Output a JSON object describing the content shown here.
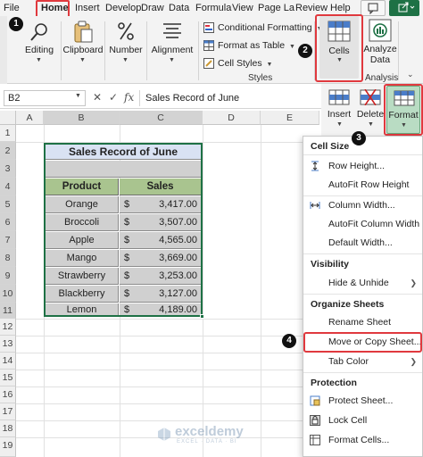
{
  "tabs": [
    "File",
    "Home",
    "Insert",
    "Develop",
    "Draw",
    "Data",
    "Formula",
    "View",
    "Page La",
    "Review",
    "Help"
  ],
  "ribbon": {
    "editing": "Editing",
    "clipboard": "Clipboard",
    "number": "Number",
    "alignment": "Alignment",
    "conditional_formatting": "Conditional Formatting",
    "format_as_table": "Format as Table",
    "cell_styles": "Cell Styles",
    "styles_group": "Styles",
    "cells": "Cells",
    "analyze_data": [
      "Analyze",
      "Data"
    ],
    "analysis_group": "Analysis"
  },
  "cells_group": {
    "insert": "Insert",
    "delete": "Delete",
    "format": "Format"
  },
  "formula_bar": {
    "name_box": "B2",
    "fx": "fx",
    "content": "Sales Record of June"
  },
  "columns": [
    "A",
    "B",
    "C",
    "D",
    "E"
  ],
  "rows": [
    "1",
    "2",
    "3",
    "4",
    "5",
    "6",
    "7",
    "8",
    "9",
    "10",
    "11",
    "12",
    "13",
    "14",
    "15",
    "16",
    "17",
    "18",
    "19"
  ],
  "sheet": {
    "title": "Sales Record of June",
    "header_product": "Product",
    "header_sales": "Sales",
    "currency": "$",
    "rows": [
      {
        "product": "Orange",
        "sales": "3,417.00"
      },
      {
        "product": "Broccoli",
        "sales": "3,507.00"
      },
      {
        "product": "Apple",
        "sales": "4,565.00"
      },
      {
        "product": "Mango",
        "sales": "3,669.00"
      },
      {
        "product": "Strawberry",
        "sales": "3,253.00"
      },
      {
        "product": "Blackberry",
        "sales": "3,127.00"
      },
      {
        "product": "Lemon",
        "sales": "4,189.00"
      }
    ]
  },
  "format_menu": {
    "cell_size": "Cell Size",
    "row_height": "Row Height...",
    "autofit_row": "AutoFit Row Height",
    "column_width": "Column Width...",
    "autofit_column": "AutoFit Column Width",
    "default_width": "Default Width...",
    "visibility": "Visibility",
    "hide_unhide": "Hide & Unhide",
    "organize_sheets": "Organize Sheets",
    "rename_sheet": "Rename Sheet",
    "move_copy": "Move or Copy Sheet...",
    "tab_color": "Tab Color",
    "protection": "Protection",
    "protect_sheet": "Protect Sheet...",
    "lock_cell": "Lock Cell",
    "format_cells": "Format Cells..."
  },
  "badges": [
    "1",
    "2",
    "3",
    "4"
  ],
  "watermark": {
    "name": "exceldemy",
    "tagline": "EXCEL · DATA · BI"
  },
  "colors": {
    "excel_green": "#1e7145",
    "header_fill": "#a9c48f",
    "title_fill": "#d9e2f3",
    "band_fill": "#d0d0d0",
    "highlight": "#e0393e"
  }
}
